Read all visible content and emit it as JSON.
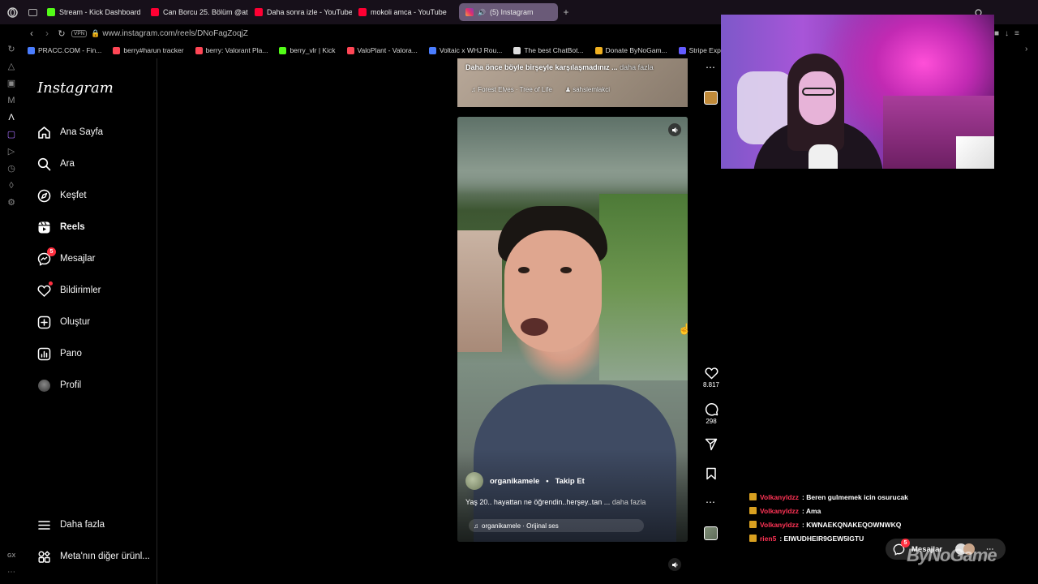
{
  "browser": {
    "tabs": [
      {
        "label": "Stream - Kick Dashboard",
        "color": "#53fc18"
      },
      {
        "label": "Can Borcu 25. Bölüm @ata",
        "color": "#ff0033"
      },
      {
        "label": "Daha sonra izle - YouTube",
        "color": "#ff0033"
      },
      {
        "label": "mokoli amca - YouTube",
        "color": "#ff0033"
      },
      {
        "label": "(5) Instagram",
        "color": "#e1306c",
        "active": true
      }
    ],
    "url": "www.instagram.com/reels/DNoFagZoqjZ",
    "vpn": "VPN",
    "bookmarks": [
      {
        "label": "PRACC.COM - Fin...",
        "color": "#4a7dff"
      },
      {
        "label": "berry#harun tracker",
        "color": "#ff4655"
      },
      {
        "label": "berry: Valorant Pla...",
        "color": "#ff4655"
      },
      {
        "label": "berry_vlr | Kick",
        "color": "#53fc18"
      },
      {
        "label": "ValoPlant - Valora...",
        "color": "#ff4655"
      },
      {
        "label": "Voltaic x WHJ Rou...",
        "color": "#4a7dff"
      },
      {
        "label": "The best ChatBot...",
        "color": "#dddddd"
      },
      {
        "label": "Donate ByNoGam...",
        "color": "#f0b020"
      },
      {
        "label": "Stripe Expr",
        "color": "#635bff"
      }
    ]
  },
  "instagram": {
    "logo": "Instagram",
    "nav": [
      {
        "label": "Ana Sayfa",
        "icon": "home-icon"
      },
      {
        "label": "Ara",
        "icon": "search-icon"
      },
      {
        "label": "Keşfet",
        "icon": "compass-icon"
      },
      {
        "label": "Reels",
        "icon": "reels-icon",
        "bold": true
      },
      {
        "label": "Mesajlar",
        "icon": "messenger-icon",
        "badge": "5"
      },
      {
        "label": "Bildirimler",
        "icon": "heart-icon",
        "dot": true
      },
      {
        "label": "Oluştur",
        "icon": "plus-square-icon"
      },
      {
        "label": "Pano",
        "icon": "dashboard-icon"
      },
      {
        "label": "Profil",
        "icon": "avatar-icon"
      }
    ],
    "more": "Daha fazla",
    "meta": "Meta'nın diğer ürünl...",
    "previous_reel": {
      "caption": "Daha önce böyle birşeyle karşılaşmadınız ...",
      "caption_more": "daha fazla",
      "audio": "Forest Elves · Tree of Life",
      "collab": "sahsiemlakci"
    },
    "reel": {
      "username": "organikamele",
      "separator": "•",
      "follow": "Takip Et",
      "caption": "Yaş 20.. hayattan ne öğrendin..herşey..tan ...",
      "caption_more": "daha fazla",
      "audio": "organikamele · Orijinal ses",
      "likes": "8.817",
      "comments": "298"
    }
  },
  "stream_overlay": {
    "chat": [
      {
        "user": "Volkanyldzz",
        "message": ": Beren gulmemek icin osurucak",
        "color": "#ff3355"
      },
      {
        "user": "Volkanyldzz",
        "message": ": Ama",
        "color": "#ff3355"
      },
      {
        "user": "Volkanyldzz",
        "message": ": KWNAEKQNAKEQOWNWKQ",
        "color": "#ff3355"
      },
      {
        "user": "rien5",
        "message": ": EIWUDHEIR9GEW5IGTU",
        "color": "#ff3355"
      }
    ],
    "messages_pill": "Mesajlar",
    "messages_badge": "5",
    "watermark": "ByNoGame"
  }
}
